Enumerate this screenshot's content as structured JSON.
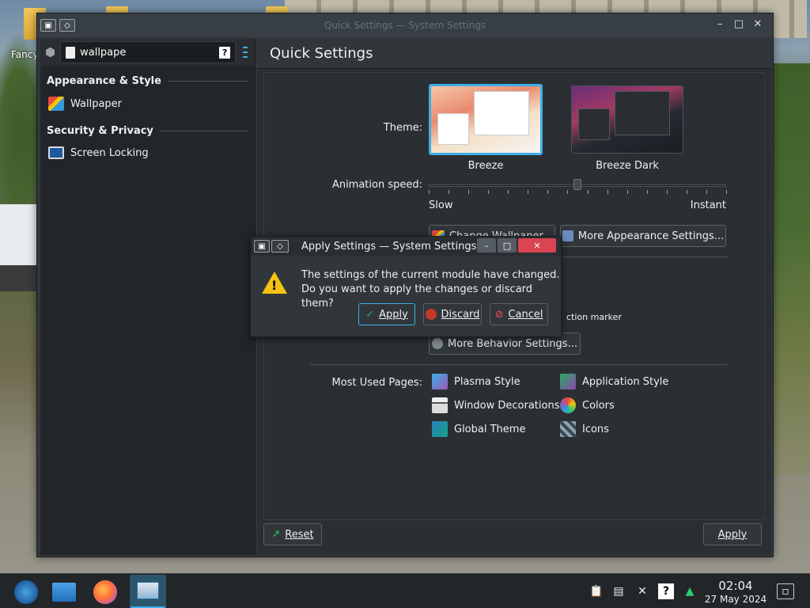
{
  "desktop": {
    "icon_label": "Fancy"
  },
  "window": {
    "title": "Quick Settings — System Settings",
    "search": {
      "value": "wallpape",
      "placeholder": ""
    },
    "header_title": "Quick Settings"
  },
  "sidebar": {
    "sections": [
      {
        "title": "Appearance & Style",
        "items": [
          {
            "label": "Wallpaper"
          }
        ]
      },
      {
        "title": "Security & Privacy",
        "items": [
          {
            "label": "Screen Locking"
          }
        ]
      }
    ]
  },
  "quick_settings": {
    "theme_label": "Theme:",
    "themes": [
      {
        "name": "Breeze",
        "selected": true
      },
      {
        "name": "Breeze Dark",
        "selected": false
      }
    ],
    "animation_label": "Animation speed:",
    "slider_min_label": "Slow",
    "slider_max_label": "Instant",
    "slider_value_fraction": 0.5,
    "change_wallpaper_label": "Change Wallpaper...",
    "more_appearance_label": "More Appearance Settings...",
    "selection_marker_label": "ction marker",
    "more_behavior_label": "More Behavior Settings...",
    "most_used_label": "Most Used Pages:",
    "most_used": [
      {
        "label": "Plasma Style",
        "icon": "plasma-style-icon"
      },
      {
        "label": "Application Style",
        "icon": "application-style-icon"
      },
      {
        "label": "Window Decorations",
        "icon": "window-decorations-icon"
      },
      {
        "label": "Colors",
        "icon": "colors-icon"
      },
      {
        "label": "Global Theme",
        "icon": "global-theme-icon"
      },
      {
        "label": "Icons",
        "icon": "icons-icon"
      }
    ],
    "reset_label": "Reset",
    "apply_label": "Apply"
  },
  "dialog": {
    "title": "Apply Settings — System Settings",
    "message_line1": "The settings of the current module have changed.",
    "message_line2": "Do you want to apply the changes or discard them?",
    "apply_label": "Apply",
    "discard_label": "Discard",
    "cancel_label": "Cancel"
  },
  "taskbar": {
    "time": "02:04",
    "date": "27 May 2024"
  },
  "colors": {
    "accent": "#3daee9",
    "window_bg": "#31363b",
    "sidebar_bg": "#232629"
  }
}
